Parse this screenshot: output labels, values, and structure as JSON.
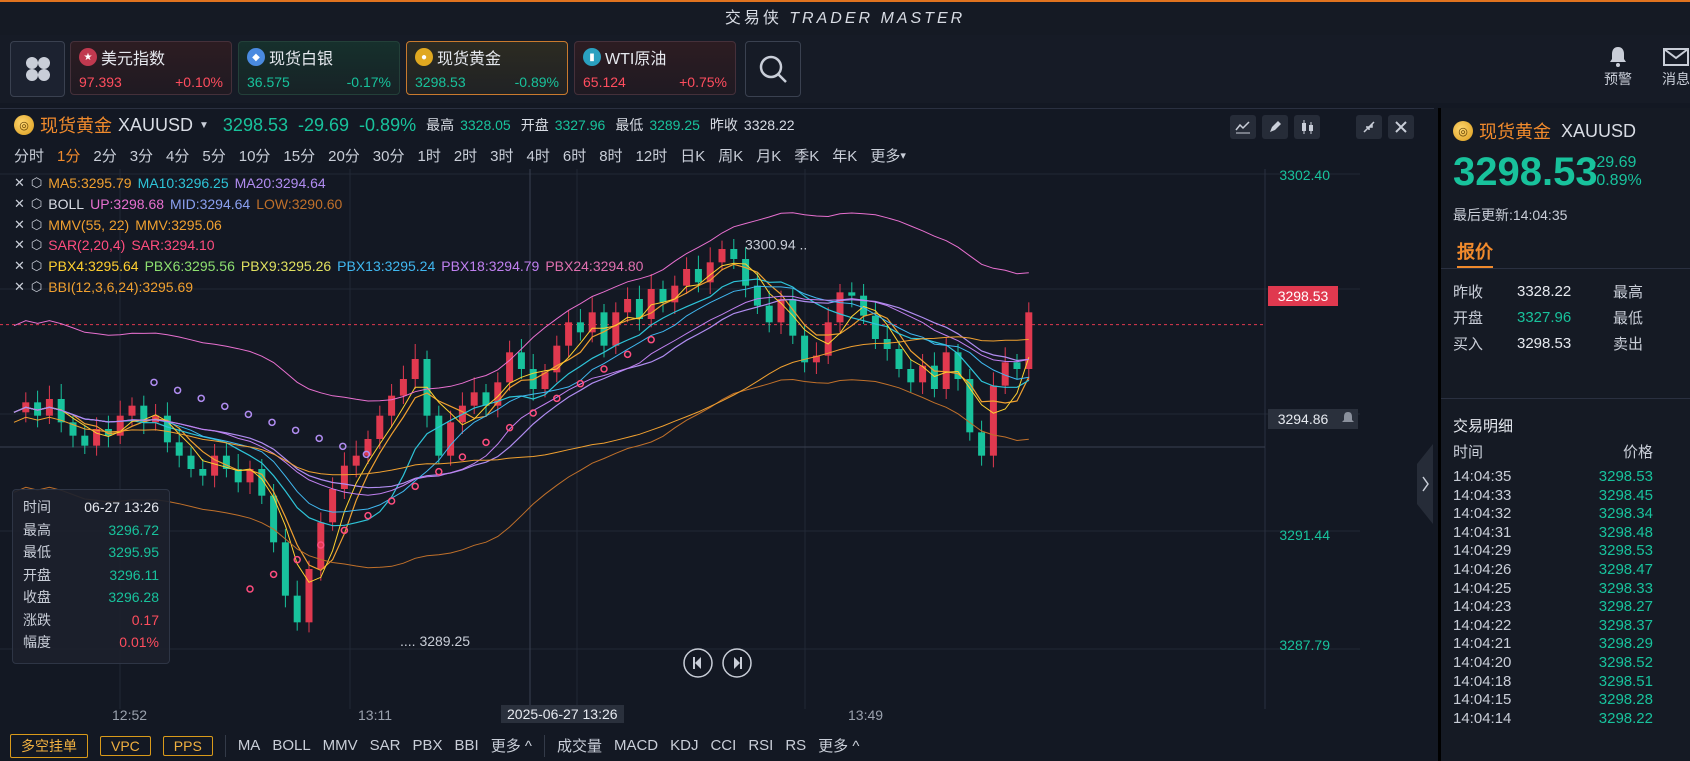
{
  "app": {
    "title_cn": "交易侠",
    "title_en": "TRADER MASTER"
  },
  "quotes": [
    {
      "name": "美元指数",
      "price": "97.393",
      "change": "+0.10%",
      "trend": "up",
      "style": "red",
      "badge": "us-flag"
    },
    {
      "name": "现货白银",
      "price": "36.575",
      "change": "-0.17%",
      "trend": "down",
      "style": "green",
      "badge": "silver"
    },
    {
      "name": "现货黄金",
      "price": "3298.53",
      "change": "-0.89%",
      "trend": "down",
      "style": "gold",
      "badge": "gold"
    },
    {
      "name": "WTI原油",
      "price": "65.124",
      "change": "+0.75%",
      "trend": "up",
      "style": "red",
      "badge": "oil"
    }
  ],
  "top_right": {
    "alert": "预警",
    "message": "消息"
  },
  "symbol": {
    "name": "现货黄金",
    "code": "XAUUSD",
    "price": "3298.53",
    "change": "-29.69",
    "pct": "-0.89%",
    "high_label": "最高",
    "high": "3328.05",
    "open_label": "开盘",
    "open": "3327.96",
    "low_label": "最低",
    "low": "3289.25",
    "prev_label": "昨收",
    "prev": "3328.22"
  },
  "intervals": [
    "分时",
    "1分",
    "2分",
    "3分",
    "4分",
    "5分",
    "10分",
    "15分",
    "20分",
    "30分",
    "1时",
    "2时",
    "3时",
    "4时",
    "6时",
    "8时",
    "12时",
    "日K",
    "周K",
    "月K",
    "季K",
    "年K",
    "更多"
  ],
  "active_interval": "1分",
  "indicators": [
    {
      "parts": [
        {
          "t": "MA5:3295.79",
          "c": "#f0a030"
        },
        {
          "t": "MA10:3296.25",
          "c": "#2ec4d8"
        },
        {
          "t": "MA20:3294.64",
          "c": "#b08cf0"
        }
      ]
    },
    {
      "parts": [
        {
          "t": "BOLL",
          "c": "#d8dce4"
        },
        {
          "t": "UP:3298.68",
          "c": "#e870d0"
        },
        {
          "t": "MID:3294.64",
          "c": "#8aa0f0"
        },
        {
          "t": "LOW:3290.60",
          "c": "#c0702a"
        }
      ]
    },
    {
      "parts": [
        {
          "t": "MMV(55, 22)",
          "c": "#f0a030"
        },
        {
          "t": "MMV:3295.06",
          "c": "#f0a030"
        }
      ]
    },
    {
      "parts": [
        {
          "t": "SAR(2,20,4)",
          "c": "#ff4d7e"
        },
        {
          "t": "SAR:3294.10",
          "c": "#ff4d7e"
        }
      ]
    },
    {
      "parts": [
        {
          "t": "PBX4:3295.64",
          "c": "#ffd030"
        },
        {
          "t": "PBX6:3295.56",
          "c": "#8ee070"
        },
        {
          "t": "PBX9:3295.26",
          "c": "#e0e060"
        },
        {
          "t": "PBX13:3295.24",
          "c": "#40b8f0"
        },
        {
          "t": "PBX18:3294.79",
          "c": "#c080f0"
        },
        {
          "t": "PBX24:3294.80",
          "c": "#e070b0"
        }
      ]
    },
    {
      "parts": [
        {
          "t": "BBI(12,3,6,24):3295.69",
          "c": "#f0a030"
        }
      ]
    }
  ],
  "tooltip": [
    {
      "k": "时间",
      "v": "06-27 13:26",
      "c": "#e6e9ef"
    },
    {
      "k": "最高",
      "v": "3296.72",
      "c": "#18c29c"
    },
    {
      "k": "最低",
      "v": "3295.95",
      "c": "#18c29c"
    },
    {
      "k": "开盘",
      "v": "3296.11",
      "c": "#18c29c"
    },
    {
      "k": "收盘",
      "v": "3296.28",
      "c": "#18c29c"
    },
    {
      "k": "涨跌",
      "v": "0.17",
      "c": "#ff4d5e"
    },
    {
      "k": "幅度",
      "v": "0.01%",
      "c": "#ff4d5e"
    }
  ],
  "y_axis": [
    "3302.40",
    "3298.53",
    "3294.86",
    "3291.44",
    "3287.79"
  ],
  "x_axis": [
    "12:52",
    "13:11",
    "2025-06-27 13:26",
    "13:49"
  ],
  "chart_annotations": {
    "high_mark": "3300.94",
    "low_mark": "3289.25"
  },
  "bottom": {
    "buttons": [
      "多空挂单",
      "VPC",
      "PPS"
    ],
    "main_ind": [
      "MA",
      "BOLL",
      "MMV",
      "SAR",
      "PBX",
      "BBI"
    ],
    "more1": "更多 ^",
    "sub_ind": [
      "成交量",
      "MACD",
      "KDJ",
      "CCI",
      "RSI",
      "RS"
    ],
    "more2": "更多 ^"
  },
  "right": {
    "name": "现货黄金",
    "code": "XAUUSD",
    "price": "3298.53",
    "change": "-29.69",
    "pct": "-0.89%",
    "updated": "最后更新:14:04:35",
    "tab": "报价",
    "quote_rows": [
      {
        "k": "昨收",
        "v": "3328.22",
        "c": "#e6e9ef",
        "k2": "最高"
      },
      {
        "k": "开盘",
        "v": "3327.96",
        "c": "#18c29c",
        "k2": "最低"
      },
      {
        "k": "买入",
        "v": "3298.53",
        "c": "#e6e9ef",
        "k2": "卖出"
      }
    ],
    "trades_title": "交易明细",
    "trades_head": [
      "时间",
      "价格"
    ],
    "trades": [
      [
        "14:04:35",
        "3298.53"
      ],
      [
        "14:04:33",
        "3298.45"
      ],
      [
        "14:04:32",
        "3298.34"
      ],
      [
        "14:04:31",
        "3298.48"
      ],
      [
        "14:04:29",
        "3298.53"
      ],
      [
        "14:04:26",
        "3298.47"
      ],
      [
        "14:04:25",
        "3298.33"
      ],
      [
        "14:04:23",
        "3298.27"
      ],
      [
        "14:04:22",
        "3298.37"
      ],
      [
        "14:04:21",
        "3298.29"
      ],
      [
        "14:04:20",
        "3298.52"
      ],
      [
        "14:04:18",
        "3298.51"
      ],
      [
        "14:04:15",
        "3298.28"
      ],
      [
        "14:04:14",
        "3298.22"
      ]
    ]
  },
  "colors": {
    "up": "#ff4d5e",
    "down": "#18c29c",
    "accent": "#f08a2c"
  }
}
